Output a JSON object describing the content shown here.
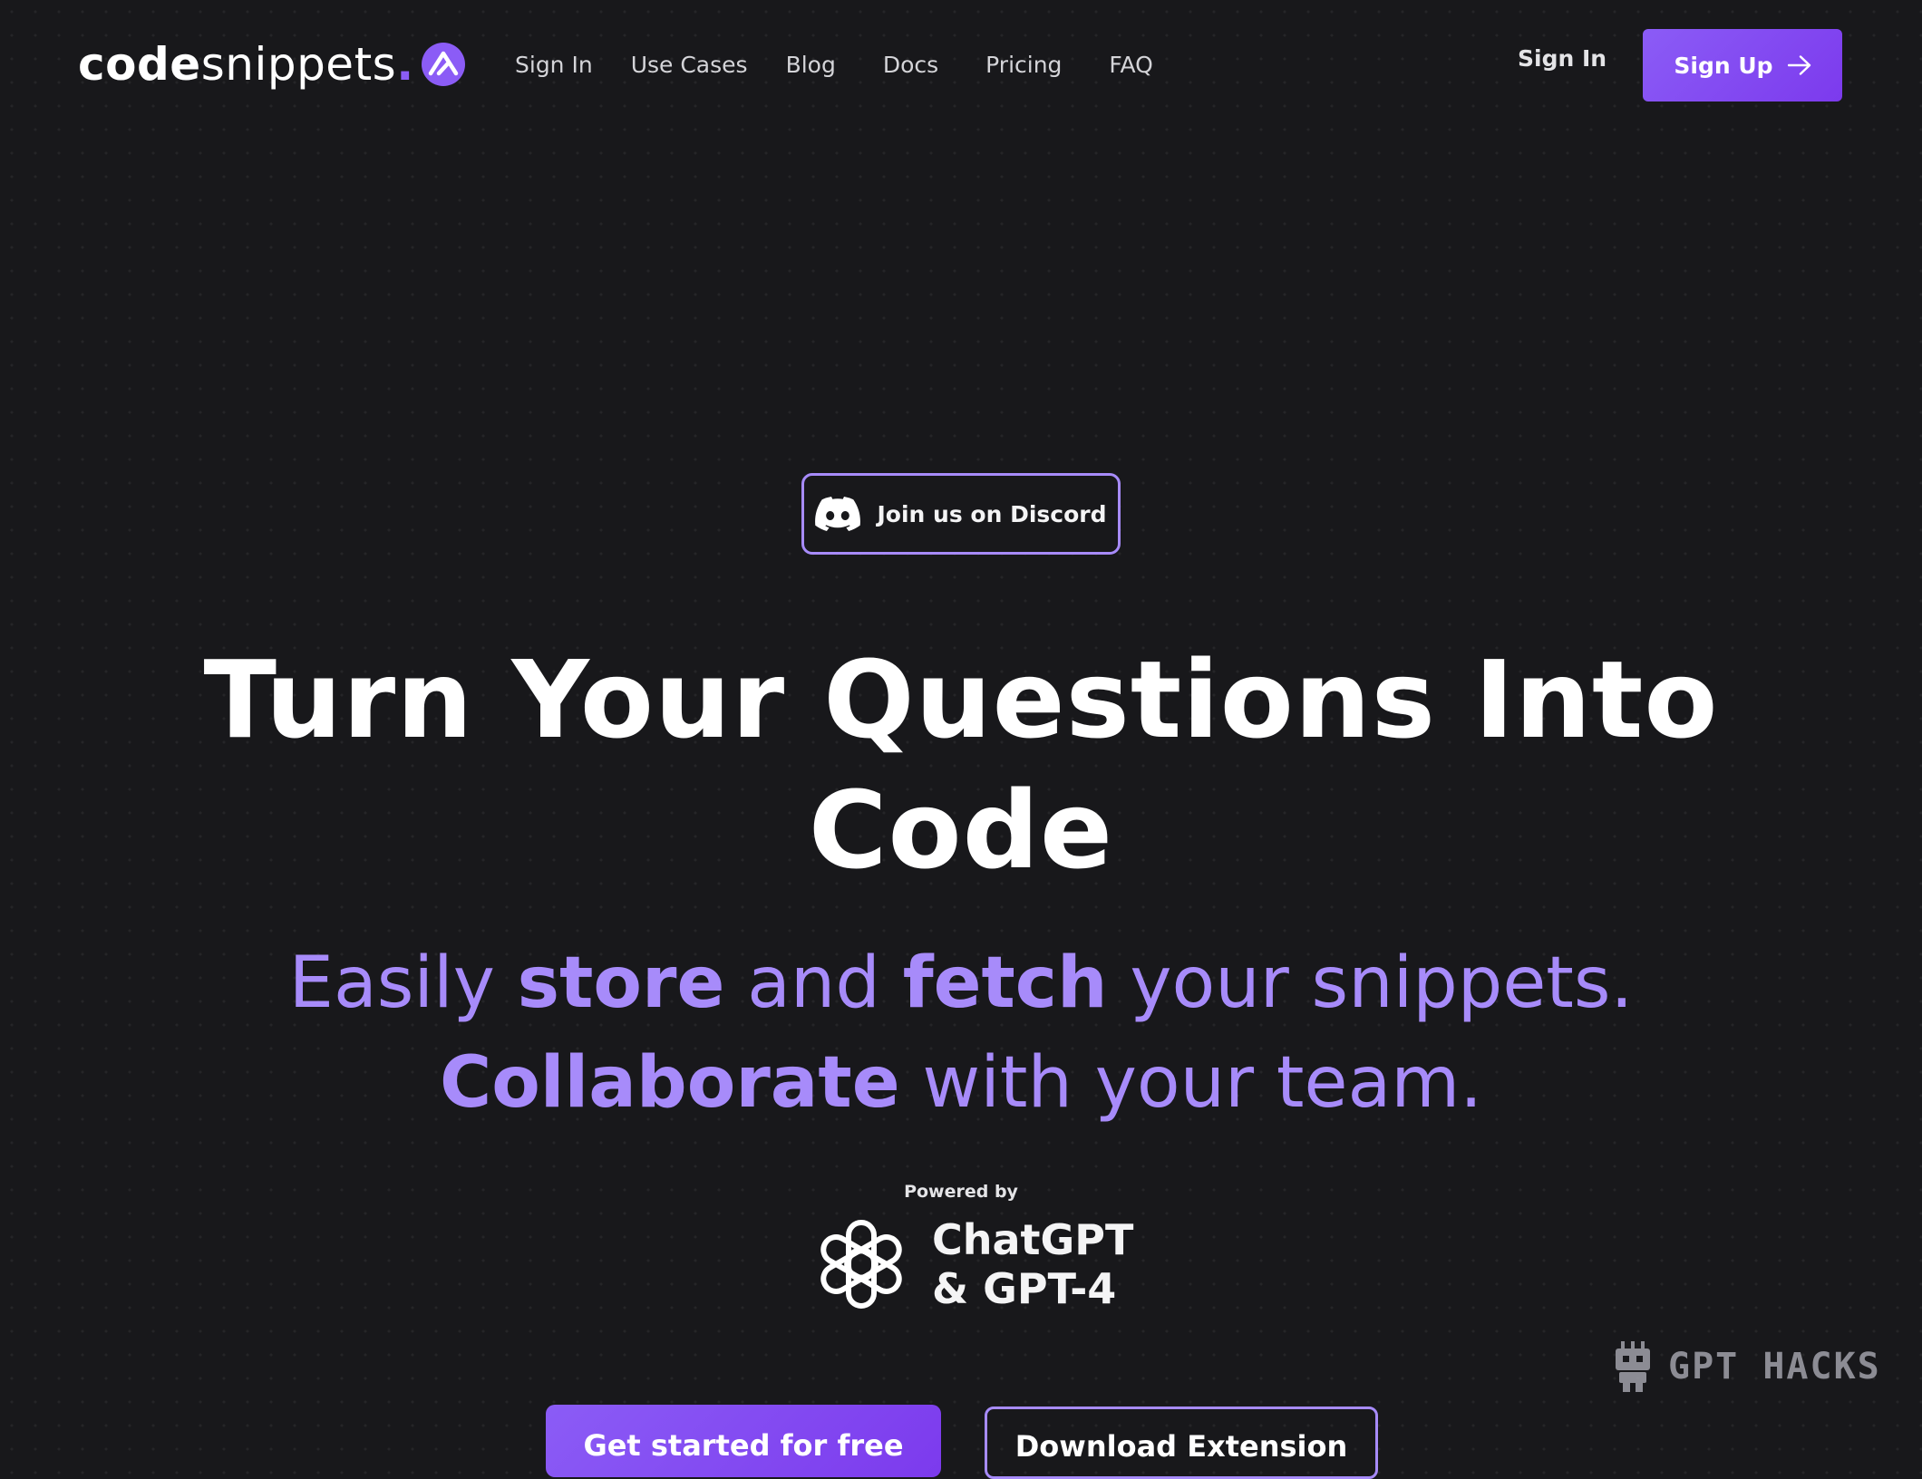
{
  "brand": {
    "name_bold": "code",
    "name_light": "snippets",
    "name_dot": ".",
    "accent_color": "#8b5cf6",
    "logo_icon": "triangle-logo-icon"
  },
  "nav": {
    "links": [
      "Sign In",
      "Use Cases",
      "Blog",
      "Docs",
      "Pricing",
      "FAQ"
    ],
    "sign_in": "Sign In",
    "sign_up": "Sign Up",
    "sign_up_icon": "arrow-right-icon"
  },
  "hero": {
    "discord_label": "Join us on Discord",
    "discord_icon": "discord-icon",
    "headline_line1": "Turn Your Questions Into",
    "headline_line2": "Code",
    "sub": {
      "part1": "Easily ",
      "bold1": "store",
      "part2": " and ",
      "bold2": "fetch",
      "part3": " your snippets.",
      "bold3": "Collaborate",
      "part4": " with your team."
    },
    "powered_by": "Powered by",
    "gpt_line1": "ChatGPT",
    "gpt_line2": "& GPT-4",
    "gpt_icon": "openai-icon"
  },
  "cta": {
    "primary": "Get started for free",
    "secondary": "Download Extension"
  },
  "watermark": {
    "text": "GPT HACKS",
    "icon": "robot-icon"
  },
  "colors": {
    "background": "#18181b",
    "accent": "#8b5cf6",
    "accent_light": "#a78bfa"
  }
}
